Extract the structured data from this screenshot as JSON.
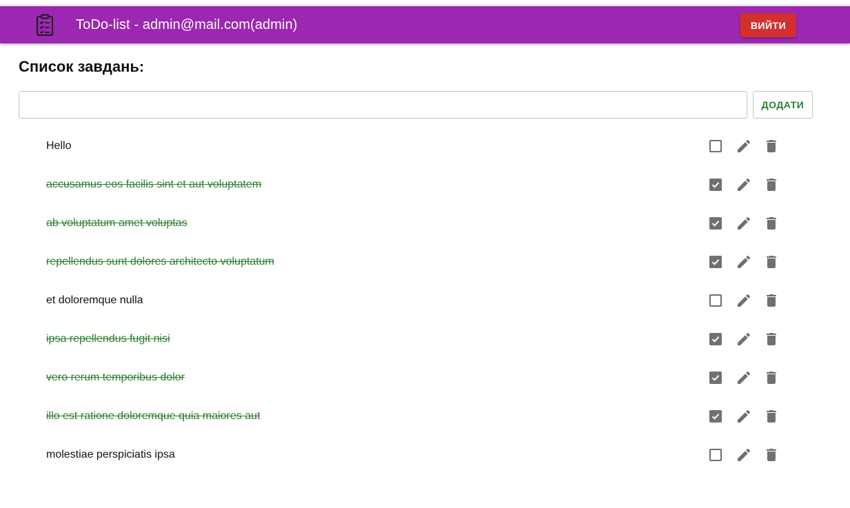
{
  "app": {
    "title": "ToDo-list - admin@mail.com(admin)",
    "logo_icon": "clipboard-list-icon",
    "logout_label": "ВИЙТИ",
    "colors": {
      "appbar": "#9c27b0",
      "logout": "#d32f2f",
      "done_text": "#2e7d32",
      "icons": "#707070"
    }
  },
  "main": {
    "title": "Список завдань:",
    "input_value": "",
    "input_placeholder": "",
    "add_label": "ДОДАТИ"
  },
  "tasks": [
    {
      "text": "Hello",
      "done": false
    },
    {
      "text": "accusamus eos facilis sint et aut voluptatem",
      "done": true
    },
    {
      "text": "ab voluptatum amet voluptas",
      "done": true
    },
    {
      "text": "repellendus sunt dolores architecto voluptatum",
      "done": true
    },
    {
      "text": "et doloremque nulla",
      "done": false
    },
    {
      "text": "ipsa repellendus fugit nisi",
      "done": true
    },
    {
      "text": "vero rerum temporibus dolor",
      "done": true
    },
    {
      "text": "illo est ratione doloremque quia maiores aut",
      "done": true
    },
    {
      "text": "molestiae perspiciatis ipsa",
      "done": false
    }
  ],
  "task_actions": {
    "edit_icon": "pencil-icon",
    "delete_icon": "trash-icon"
  }
}
